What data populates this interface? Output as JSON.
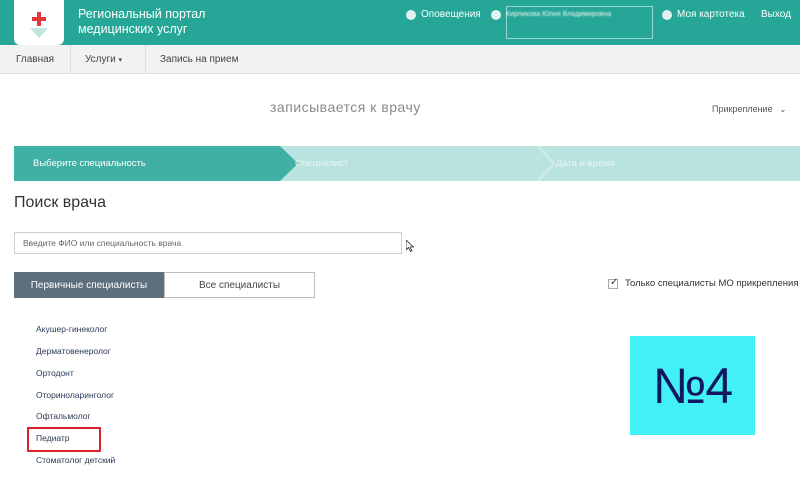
{
  "header": {
    "portal_title": "Региональный портал медицинских услуг",
    "notifications": "Оповещения",
    "user_name": "Кирпикова Юлия Владимировна",
    "my_card": "Моя картотека",
    "logout": "Выход",
    "colors": {
      "header_bg": "#25a696",
      "logo_cross": "#e03a3a"
    }
  },
  "breadcrumb": {
    "home": "Главная",
    "services": "Услуги",
    "services_arrow": "▾",
    "current": "Запись на прием"
  },
  "page": {
    "heading": "записывается к врачу",
    "attach_link": "Прикрепление",
    "attach_arrow": "⌄"
  },
  "steps": [
    {
      "label": "Выберите специальность",
      "state": "active"
    },
    {
      "label": "Специалист",
      "state": "inactive"
    },
    {
      "label": "Дата и время",
      "state": "inactive"
    }
  ],
  "search": {
    "title": "Поиск врача",
    "placeholder": "Введите ФИО или специальность врача"
  },
  "tabs": {
    "primary": "Первичные специалисты",
    "all": "Все специалисты"
  },
  "filter": {
    "checked": true,
    "checkmark": "✓",
    "label": "Только специалисты МО прикрепления"
  },
  "specialties": [
    "Акушер-гинеколог",
    "Дерматовенеролог",
    "Ортодонт",
    "Оториноларинголог",
    "Офтальмолог",
    "Педиатр",
    "Стоматолог детский"
  ],
  "overlay": {
    "number_label": "№4",
    "box_color": "#42f0f5",
    "highlight_color": "#d9232d"
  }
}
